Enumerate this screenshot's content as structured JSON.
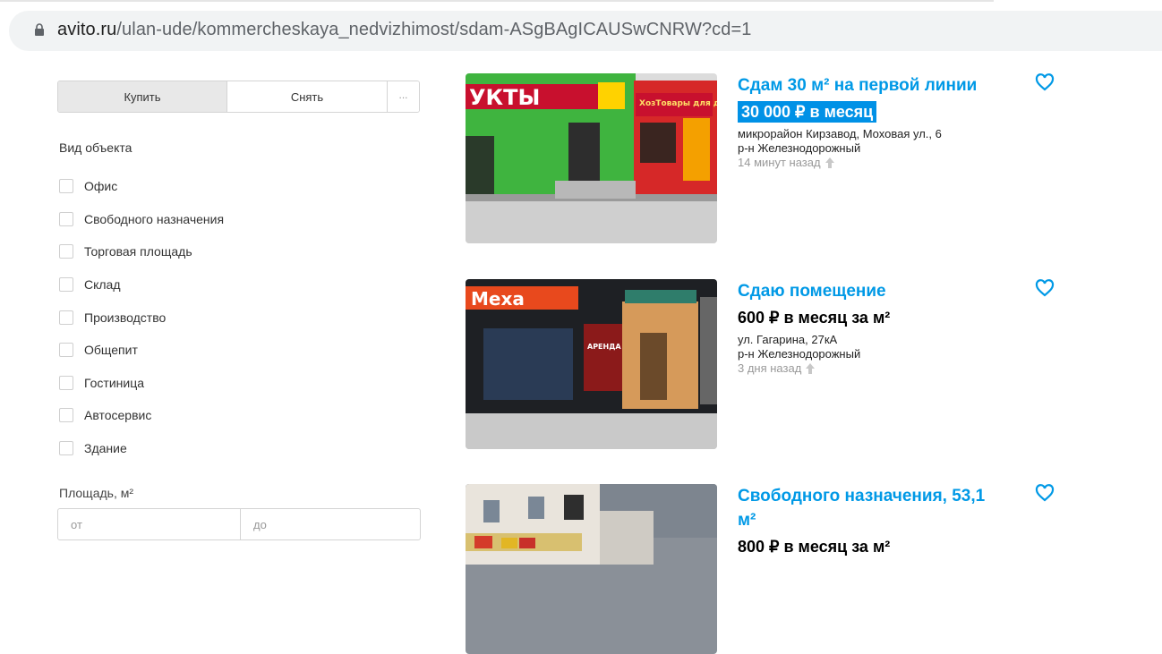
{
  "browser": {
    "url_host": "avito.ru",
    "url_path": "/ulan-ude/kommercheskaya_nedvizhimost/sdam-ASgBAgICAUSwCNRW?cd=1",
    "lock_icon": "lock-icon"
  },
  "filters": {
    "deal_tabs": {
      "buy": "Купить",
      "rent": "Снять",
      "more": "..."
    },
    "object_type_title": "Вид объекта",
    "object_types": [
      "Офис",
      "Свободного назначения",
      "Торговая площадь",
      "Склад",
      "Производство",
      "Общепит",
      "Гостиница",
      "Автосервис",
      "Здание"
    ],
    "area_title": "Площадь, м²",
    "area_from_placeholder": "от",
    "area_to_placeholder": "до"
  },
  "listings": [
    {
      "title": "Сдам 30 м² на первой линии",
      "price": "30 000 ₽ в месяц",
      "address": "микрорайон Кирзавод, Моховая ул., 6",
      "district": "р-н Железнодорожный",
      "time": "14 минут назад",
      "photo_text_1": "УКТЫ",
      "photo_text_2": "ХозТовары для дома"
    },
    {
      "title": "Сдаю помещение",
      "price": "600 ₽ в месяц за м²",
      "address": "ул. Гагарина, 27кА",
      "district": "р-н Железнодорожный",
      "time": "3 дня назад",
      "photo_text_1": "Меха",
      "photo_text_2": "АРЕНДА"
    },
    {
      "title": "Свободного назначения, 53,1 м²",
      "price": "800 ₽ в месяц за м²"
    }
  ],
  "colors": {
    "link_blue": "#0099e6",
    "price_highlight": "#0091e6",
    "muted_gray": "#999999"
  }
}
